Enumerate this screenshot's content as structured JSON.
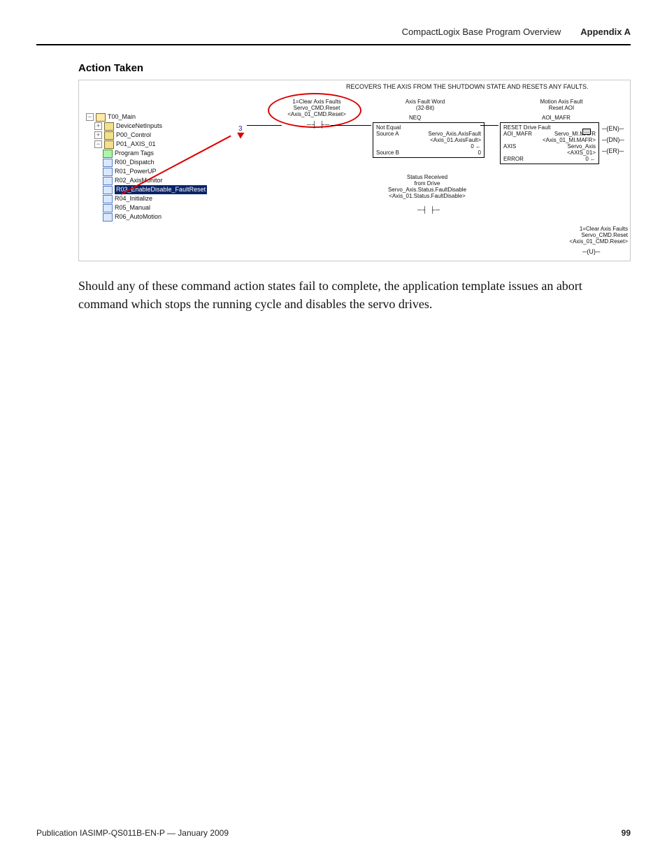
{
  "header": {
    "title": "CompactLogix Base Program Overview",
    "appendix": "Appendix A"
  },
  "section": {
    "heading": "Action Taken"
  },
  "figure": {
    "top_comment": "RECOVERS THE AXIS FROM THE SHUTDOWN STATE AND RESETS ANY FAULTS.",
    "rung_number": "3",
    "tree": {
      "root": "T00_Main",
      "items": [
        "DeviceNetInputs",
        "P00_Control",
        "P01_AXIS_01",
        "Program Tags",
        "R00_Dispatch",
        "R01_PowerUP",
        "R02_AxisMonitor",
        "R03_EnableDisable_FaultReset",
        "R04_Initialize",
        "R05_Manual",
        "R06_AutoMotion"
      ]
    },
    "xic": {
      "l1": "1=Clear Axis Faults",
      "l2": "Servo_CMD.Reset",
      "l3": "<Axis_01_CMD.Reset>"
    },
    "neq": {
      "title_l1": "Axis Fault Word",
      "title_l2": "(32-Bit)",
      "short": "NEQ",
      "label": "Not Equal",
      "sa_k": "Source A",
      "sa_v": "Servo_Axis.AxisFault",
      "sa_tag": "<Axis_01.AxisFault>",
      "sa_val": "0 ←",
      "sb_k": "Source B",
      "sb_v": "0"
    },
    "xic2": {
      "l1": "Status Received",
      "l2": "from Drive",
      "l3": "Servo_Axis.Status.FaultDisable",
      "l4": "<Axis_01.Status.FaultDisable>"
    },
    "aoi": {
      "title_l1": "Motion Axis Fault",
      "title_l2": "Reset AOI",
      "short": "AOI_MAFR",
      "label": "RESET Drive Fault",
      "r1k": "AOI_MAFR",
      "r1v": "Servo_MI.MAFR",
      "r1tag": "<Axis_01_MI.MAFR>",
      "r2k": "AXIS",
      "r2v": "Servo_Axis",
      "r2tag": "<AXIS_01>",
      "r3k": "ERROR",
      "r3v": "0 ←",
      "en": "(EN)",
      "dn": "(DN)",
      "er": "(ER)"
    },
    "out": {
      "l1": "1=Clear Axis Faults",
      "l2": "Servo_CMD.Reset",
      "l3": "<Axis_01_CMD.Reset>",
      "coil": "(U)"
    }
  },
  "body": {
    "paragraph": "Should any of these command action states fail to complete, the application template issues an abort command which stops the running cycle and disables the servo drives."
  },
  "footer": {
    "pub": "Publication IASIMP-QS011B-EN-P — January 2009",
    "page": "99"
  }
}
